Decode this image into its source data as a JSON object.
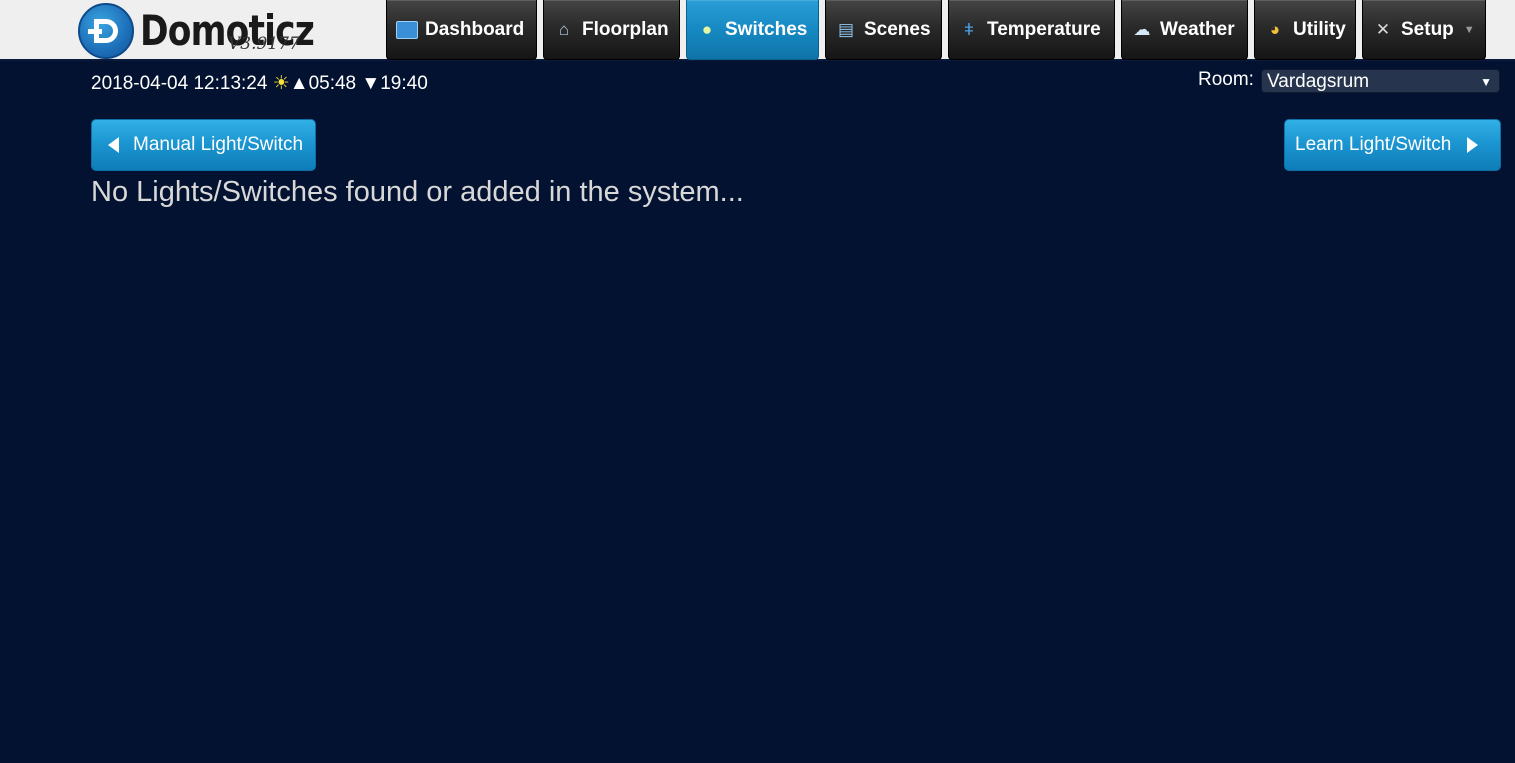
{
  "app": {
    "name": "Domoticz",
    "version": "V3.9177"
  },
  "nav": [
    {
      "label": "Dashboard",
      "icon": "dashboard-icon",
      "active": false
    },
    {
      "label": "Floorplan",
      "icon": "floorplan-icon",
      "active": false
    },
    {
      "label": "Switches",
      "icon": "lightbulb-icon",
      "active": true
    },
    {
      "label": "Scenes",
      "icon": "clapperboard-icon",
      "active": false
    },
    {
      "label": "Temperature",
      "icon": "thermometer-icon",
      "active": false
    },
    {
      "label": "Weather",
      "icon": "rain-cloud-icon",
      "active": false
    },
    {
      "label": "Utility",
      "icon": "gauge-icon",
      "active": false
    },
    {
      "label": "Setup",
      "icon": "tools-icon",
      "active": false,
      "has_dropdown": true
    }
  ],
  "status": {
    "datetime": "2018-04-04 12:13:24",
    "sunrise": "05:48",
    "sunset": "19:40"
  },
  "room": {
    "label": "Room:",
    "selected": "Vardagsrum"
  },
  "actions": {
    "manual_label": "Manual Light/Switch",
    "learn_label": "Learn Light/Switch"
  },
  "main": {
    "empty_message": "No Lights/Switches found or added in the system..."
  },
  "colors": {
    "background": "#021230",
    "active_tab": "#1689c2",
    "button": "#1a93cf"
  }
}
